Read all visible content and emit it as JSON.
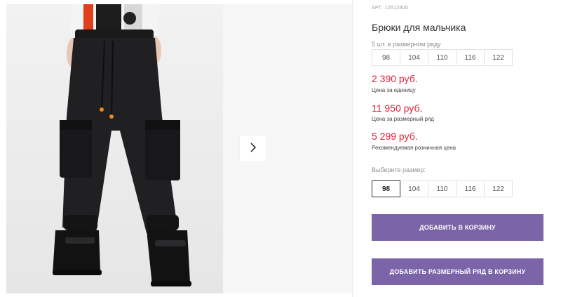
{
  "product": {
    "article_label": "АРТ.",
    "article_code": "12512400",
    "title": "Брюки для мальчика"
  },
  "pack": {
    "label": "5 шт. в размерном ряду",
    "sizes": [
      "98",
      "104",
      "110",
      "116",
      "122"
    ]
  },
  "prices": [
    {
      "value": "2 390 руб.",
      "note": "Цена за единицу"
    },
    {
      "value": "11 950 руб.",
      "note": "Цена за размерный ряд"
    },
    {
      "value": "5 299 руб.",
      "note": "Рекомендуемая розничная цена"
    }
  ],
  "size_picker": {
    "label": "Выберите размер:",
    "sizes": [
      "98",
      "104",
      "110",
      "116",
      "122"
    ],
    "selected": "98"
  },
  "buttons": {
    "add_to_cart": "ДОБАВИТЬ В КОРЗИНУ",
    "add_size_row": "ДОБАВИТЬ РАЗМЕРНЫЙ РЯД В КОРЗИНУ"
  },
  "gallery": {
    "next_icon": "chevron-right-icon"
  },
  "colors": {
    "price": "#e02239",
    "button": "#7b64a8"
  }
}
